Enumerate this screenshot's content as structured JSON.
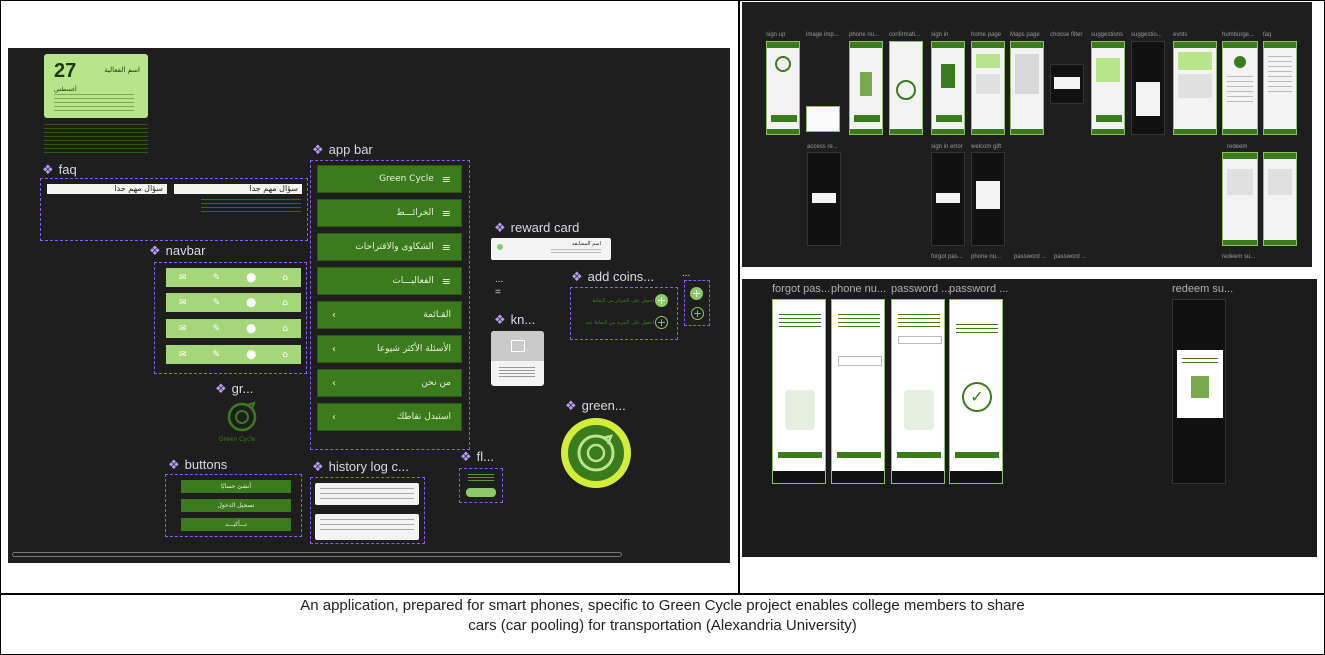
{
  "left_panel": {
    "event_card": {
      "day": "27",
      "month": "أغسطس",
      "title": "اسم الفعالية"
    },
    "components": {
      "faq": "faq",
      "app_bar": "app bar",
      "navbar": "navbar",
      "reward_card": "reward card",
      "add_coins": "add coins...",
      "kn": "kn...",
      "gr": "gr...",
      "buttons": "buttons",
      "history_log": "history log c...",
      "fl": "fl...",
      "green": "green...",
      "ellipsis": "..."
    },
    "faq_questions": [
      "سؤال مهم جدا",
      "سؤال مهم جدا"
    ],
    "app_bar_items": [
      "Green Cycle",
      "الخرائـــط",
      "الشكاوى والاقتراحات",
      "الفعاليـــات",
      "القـائمة",
      "الأسئلة الأكثر شيوعا",
      "من نحن",
      "استبدل نقاطك"
    ],
    "logo_caption": "Green Cycle",
    "buttons": [
      "أنشئ حسابًا",
      "تسجيل الدخول",
      "تـــأكيـــد"
    ],
    "reward_text": "اسم المسابقة",
    "add_coins_rows": [
      "احصل على الجوائز من النقاط",
      "احصل على المزيد من النقاط عند"
    ]
  },
  "top_right_panel": {
    "screens": [
      "sign up",
      "image imp...",
      "phone nu...",
      "confirmati...",
      "sign in",
      "home page",
      "Maps page",
      "choose filter",
      "suggestions",
      "suggestio...",
      "evnts",
      "humburge...",
      "faq"
    ],
    "second_row": [
      "access re...",
      "sign in error",
      "welcom gift",
      "redeem"
    ],
    "bottom_row": [
      "forgot pas...",
      "phone nu...",
      "password ...",
      "password ...",
      "redeem su..."
    ]
  },
  "bottom_right_panel": {
    "screens": [
      "forgot pas...",
      "phone nu...",
      "password ...",
      "password ...",
      "redeem su..."
    ]
  },
  "caption": {
    "line1": "An application, prepared for smart phones, specific to Green Cycle project enables college members to share",
    "line2": "cars (car pooling) for transportation (Alexandria University)"
  }
}
